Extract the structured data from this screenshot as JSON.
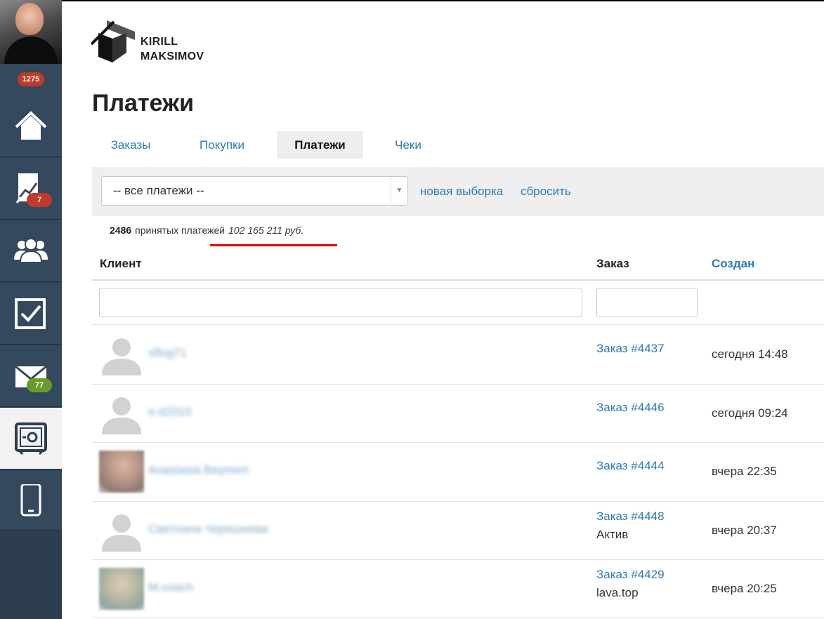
{
  "sidebar": {
    "top_badge": "1275",
    "stats_badge": "7",
    "mail_badge": "77"
  },
  "brand": {
    "line1": "KIRILL",
    "line2": "MAKSIMOV"
  },
  "page_title": "Платежи",
  "tabs": [
    {
      "label": "Заказы",
      "active": false
    },
    {
      "label": "Покупки",
      "active": false
    },
    {
      "label": "Платежи",
      "active": true
    },
    {
      "label": "Чеки",
      "active": false
    }
  ],
  "filter": {
    "select_value": "-- все платежи --",
    "new_selection": "новая выборка",
    "reset": "сбросить"
  },
  "summary": {
    "count": "2486",
    "label": "принятых платежей",
    "sum": "102 165 211 руб."
  },
  "table": {
    "headers": {
      "client": "Клиент",
      "order": "Заказ",
      "created": "Создан"
    },
    "rows": [
      {
        "client": "sflog71",
        "order": "Заказ #4437",
        "order_sub": "",
        "created": "сегодня 14:48"
      },
      {
        "client": "e.d2010",
        "order": "Заказ #4446",
        "order_sub": "",
        "created": "сегодня 09:24"
      },
      {
        "client": "Anastasia Beymert",
        "order": "Заказ #4444",
        "order_sub": "",
        "created": "вчера 22:35"
      },
      {
        "client": "Светлана Черешнева",
        "order": "Заказ #4448",
        "order_sub": "Актив",
        "created": "вчера 20:37"
      },
      {
        "client": "M.coach",
        "order": "Заказ #4429",
        "order_sub": "lava.top",
        "created": "вчера 20:25"
      }
    ]
  },
  "colors": {
    "sidebar": "#34495e",
    "link": "#2d7ab5",
    "badge_red": "#c0392b",
    "badge_green": "#6a9a2a",
    "underline": "#e00000"
  }
}
